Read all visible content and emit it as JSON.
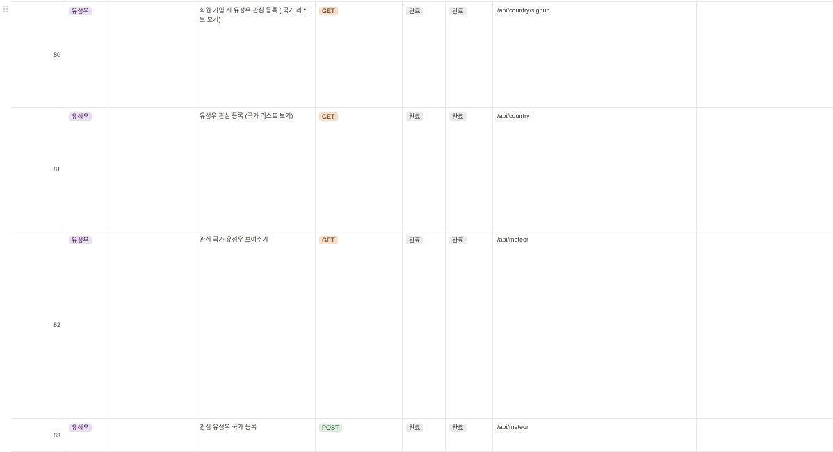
{
  "colors": {
    "owner_tag": "#eadff1",
    "get_tag": "#fadec9",
    "post_tag": "#dbeddb",
    "status_tag": "#ebeced",
    "grid_line": "#e9e9e7"
  },
  "rows": [
    {
      "num": "80",
      "owner": "유성우",
      "title": "회원 가입 시 유성우 관심 등록 ( 국가 리스트 보기)",
      "method": "GET",
      "status1": "완료",
      "status2": "완료",
      "url": "/api/country/signup"
    },
    {
      "num": "81",
      "owner": "유성우",
      "title": "유성우 관심 등록 (국가 리스트 보기)",
      "method": "GET",
      "status1": "완료",
      "status2": "완료",
      "url": "/api/country"
    },
    {
      "num": "82",
      "owner": "유성우",
      "title": "관심 국가 유성우 보여주기",
      "method": "GET",
      "status1": "완료",
      "status2": "완료",
      "url": "/api/meteor"
    },
    {
      "num": "83",
      "owner": "유성우",
      "title": "관심 유성우 국가 등록",
      "method": "POST",
      "status1": "완료",
      "status2": "완료",
      "url": "/api/meteor"
    }
  ]
}
